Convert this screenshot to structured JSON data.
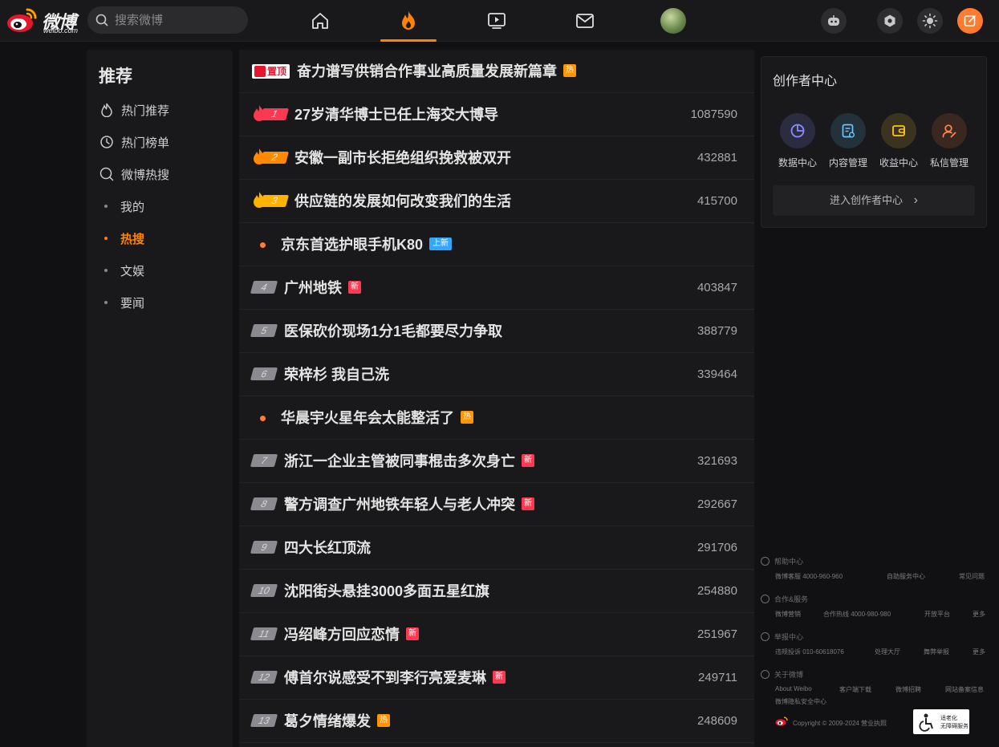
{
  "header": {
    "logo_text": "微博",
    "logo_sub": "weibo.com",
    "search_placeholder": "搜索微博",
    "nav_icons": [
      "home-icon",
      "hot-flame-icon",
      "video-icon",
      "mail-icon",
      "avatar"
    ],
    "right_icons": [
      "robot-icon",
      "settings-icon",
      "theme-sun-icon",
      "compose-icon"
    ],
    "accent_color": "#ff8200"
  },
  "sidebar": {
    "title": "推荐",
    "items": [
      {
        "label": "热门推荐",
        "icon": "flame-icon"
      },
      {
        "label": "热门榜单",
        "icon": "clock-icon"
      },
      {
        "label": "微博热搜",
        "icon": "search-hot-icon"
      }
    ],
    "sub_items": [
      {
        "label": "我的",
        "active": false
      },
      {
        "label": "热搜",
        "active": true
      },
      {
        "label": "文娱",
        "active": false
      },
      {
        "label": "要闻",
        "active": false
      }
    ]
  },
  "hot_list": {
    "pinned": {
      "badge": "置顶",
      "title": "奋力谱写供销合作事业高质量发展新篇章",
      "tag": "热"
    },
    "items": [
      {
        "rank": "1",
        "title": "27岁清华博士已任上海交大博导",
        "count": "1087590",
        "tag": "",
        "style": "top"
      },
      {
        "rank": "2",
        "title": "安徽一副市长拒绝组织挽救被双开",
        "count": "432881",
        "tag": "",
        "style": "top"
      },
      {
        "rank": "3",
        "title": "供应链的发展如何改变我们的生活",
        "count": "415700",
        "tag": "",
        "style": "top"
      },
      {
        "rank": "",
        "title": "京东首选护眼手机K80",
        "count": "",
        "tag": "上新",
        "style": "promo"
      },
      {
        "rank": "4",
        "title": "广州地铁",
        "count": "403847",
        "tag": "新",
        "style": "normal"
      },
      {
        "rank": "5",
        "title": "医保砍价现场1分1毛都要尽力争取",
        "count": "388779",
        "tag": "",
        "style": "normal"
      },
      {
        "rank": "6",
        "title": "荣梓杉 我自己洗",
        "count": "339464",
        "tag": "",
        "style": "normal"
      },
      {
        "rank": "",
        "title": "华晨宇火星年会太能整活了",
        "count": "",
        "tag": "热",
        "style": "promo"
      },
      {
        "rank": "7",
        "title": "浙江一企业主管被同事棍击多次身亡",
        "count": "321693",
        "tag": "新",
        "style": "normal"
      },
      {
        "rank": "8",
        "title": "警方调查广州地铁年轻人与老人冲突",
        "count": "292667",
        "tag": "新",
        "style": "normal"
      },
      {
        "rank": "9",
        "title": "四大长红顶流",
        "count": "291706",
        "tag": "",
        "style": "normal"
      },
      {
        "rank": "10",
        "title": "沈阳街头悬挂3000多面五星红旗",
        "count": "254880",
        "tag": "",
        "style": "normal"
      },
      {
        "rank": "11",
        "title": "冯绍峰方回应恋情",
        "count": "251967",
        "tag": "新",
        "style": "normal"
      },
      {
        "rank": "12",
        "title": "傅首尔说感受不到李行亮爱麦琳",
        "count": "249711",
        "tag": "新",
        "style": "normal"
      },
      {
        "rank": "13",
        "title": "葛夕情绪爆发",
        "count": "248609",
        "tag": "热",
        "style": "normal"
      }
    ]
  },
  "creator": {
    "title": "创作者中心",
    "items": [
      {
        "label": "数据中心",
        "icon": "data-chart-icon"
      },
      {
        "label": "内容管理",
        "icon": "content-doc-icon"
      },
      {
        "label": "收益中心",
        "icon": "wallet-icon"
      },
      {
        "label": "私信管理",
        "icon": "user-message-icon"
      }
    ],
    "enter_label": "进入创作者中心",
    "enter_chevron": "›"
  },
  "footer": {
    "sections": [
      {
        "head": "帮助中心",
        "links": [
          "微博客服 4000-960-960",
          "自助服务中心",
          "常见问题"
        ]
      },
      {
        "head": "合作&服务",
        "links": [
          "微博营销",
          "合作热线 4000-980-980",
          "开放平台",
          "更多"
        ]
      },
      {
        "head": "举报中心",
        "links": [
          "违规投诉 010-60618076",
          "处理大厅",
          "舞弊举报",
          "更多"
        ]
      },
      {
        "head": "关于微博",
        "links": [
          "About Weibo",
          "客户端下载",
          "微博招聘",
          "网站备案信息",
          "微博隐私安全中心"
        ]
      }
    ],
    "copyright": "Copyright © 2009-2024 营业执照",
    "access_line1": "适老化",
    "access_line2": "无障碍服务"
  }
}
